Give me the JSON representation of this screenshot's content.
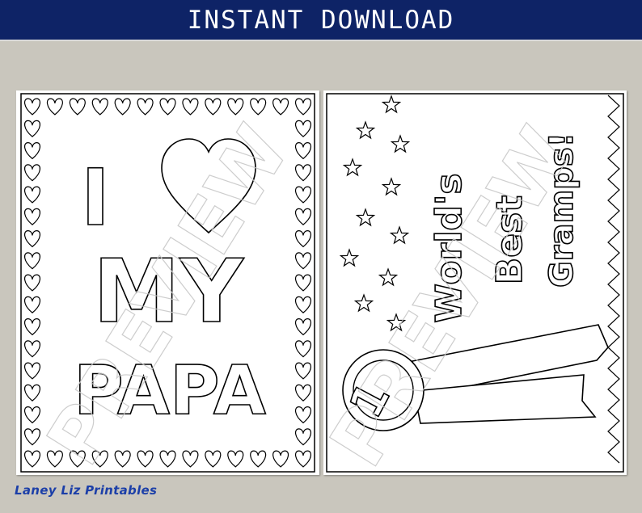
{
  "banner": {
    "title": "INSTANT DOWNLOAD",
    "background": "#0e2366"
  },
  "left_card": {
    "line1_letter": "I",
    "heart_icon": "heart-icon",
    "line2": "MY",
    "line3": "PAPA",
    "border_icon": "heart-icon",
    "watermark": "PREVIEW"
  },
  "right_card": {
    "text1": "World's",
    "text2": "Best",
    "text3": "Gramps!",
    "ribbon_number": "1",
    "decoration_icons": [
      "star-icon",
      "ribbon-icon",
      "zigzag-border"
    ],
    "watermark": "PREVIEW"
  },
  "brand": {
    "name": "Laney Liz Printables",
    "color": "#1c3fa8"
  },
  "colors": {
    "background": "#c9c6bd",
    "paper": "#ffffff",
    "line": "#000000"
  }
}
